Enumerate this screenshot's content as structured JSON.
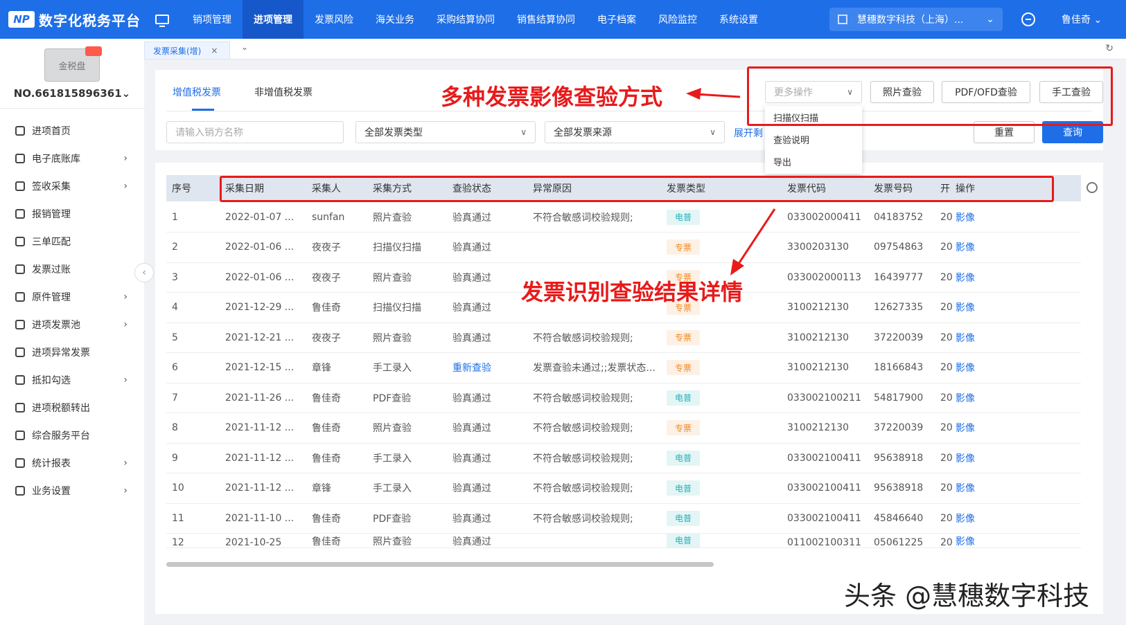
{
  "app": {
    "logo_mark": "NP",
    "title": "数字化税务平台"
  },
  "nav": [
    {
      "label": "销项管理",
      "active": false
    },
    {
      "label": "进项管理",
      "active": true
    },
    {
      "label": "发票风险",
      "active": false
    },
    {
      "label": "海关业务",
      "active": false
    },
    {
      "label": "采购结算协同",
      "active": false
    },
    {
      "label": "销售结算协同",
      "active": false
    },
    {
      "label": "电子档案",
      "active": false
    },
    {
      "label": "风险监控",
      "active": false
    },
    {
      "label": "系统设置",
      "active": false
    }
  ],
  "company": "慧穗数字科技（上海）...",
  "user": "鲁佳奇 ⌄",
  "sidebar": {
    "disk_label": "金税盘",
    "disk_no": "NO.661815896361⌄",
    "items": [
      {
        "label": "进项首页",
        "arrow": ""
      },
      {
        "label": "电子底账库",
        "arrow": "›"
      },
      {
        "label": "签收采集",
        "arrow": "›"
      },
      {
        "label": "报销管理",
        "arrow": ""
      },
      {
        "label": "三单匹配",
        "arrow": ""
      },
      {
        "label": "发票过账",
        "arrow": ""
      },
      {
        "label": "原件管理",
        "arrow": "›"
      },
      {
        "label": "进项发票池",
        "arrow": "›"
      },
      {
        "label": "进项异常发票",
        "arrow": ""
      },
      {
        "label": "抵扣勾选",
        "arrow": "›"
      },
      {
        "label": "进项税额转出",
        "arrow": ""
      },
      {
        "label": "综合服务平台",
        "arrow": ""
      },
      {
        "label": "统计报表",
        "arrow": "›"
      },
      {
        "label": "业务设置",
        "arrow": "›"
      }
    ]
  },
  "tabs": {
    "active_tab": "发票采集(增)",
    "close": "×",
    "more": "⌄",
    "refresh": "↻"
  },
  "filter": {
    "vtab_vat": "增值税发票",
    "vtab_nonvat": "非增值税发票",
    "seller_placeholder": "请输入销方名称",
    "invoice_type": "全部发票类型",
    "invoice_source": "全部发票来源",
    "expand": "展开剩",
    "more_ops": "更多操作",
    "photo_check": "照片查验",
    "pdf_check": "PDF/OFD查验",
    "manual_check": "手工查验",
    "reset": "重置",
    "query": "查询"
  },
  "dropdown": [
    "扫描仪扫描",
    "查验说明",
    "导出"
  ],
  "table": {
    "headers": [
      "序号",
      "采集日期",
      "采集人",
      "采集方式",
      "查验状态",
      "异常原因",
      "发票类型",
      "发票代码",
      "发票号码",
      "开",
      "操作"
    ],
    "rows": [
      {
        "no": "1",
        "date": "2022-01-07 ...",
        "person": "sunfan",
        "method": "照片查验",
        "status": "验真通过",
        "status_link": false,
        "reason": "不符合敏感词校验规则;",
        "type": "电普",
        "type_kind": "ep",
        "code": "033002000411",
        "num": "04183752",
        "open": "20",
        "op": "影像"
      },
      {
        "no": "2",
        "date": "2022-01-06 ...",
        "person": "夜夜子",
        "method": "扫描仪扫描",
        "status": "验真通过",
        "status_link": false,
        "reason": "",
        "type": "专票",
        "type_kind": "zp",
        "code": "3300203130",
        "num": "09754863",
        "open": "20",
        "op": "影像"
      },
      {
        "no": "3",
        "date": "2022-01-06 ...",
        "person": "夜夜子",
        "method": "照片查验",
        "status": "验真通过",
        "status_link": false,
        "reason": "",
        "type": "专票",
        "type_kind": "zp",
        "code": "033002000113",
        "num": "16439777",
        "open": "20",
        "op": "影像"
      },
      {
        "no": "4",
        "date": "2021-12-29 ...",
        "person": "鲁佳奇",
        "method": "扫描仪扫描",
        "status": "验真通过",
        "status_link": false,
        "reason": "",
        "type": "专票",
        "type_kind": "zp",
        "code": "3100212130",
        "num": "12627335",
        "open": "20",
        "op": "影像"
      },
      {
        "no": "5",
        "date": "2021-12-21 ...",
        "person": "夜夜子",
        "method": "照片查验",
        "status": "验真通过",
        "status_link": false,
        "reason": "不符合敏感词校验规则;",
        "type": "专票",
        "type_kind": "zp",
        "code": "3100212130",
        "num": "37220039",
        "open": "20",
        "op": "影像"
      },
      {
        "no": "6",
        "date": "2021-12-15 ...",
        "person": "章锋",
        "method": "手工录入",
        "status": "重新查验",
        "status_link": true,
        "reason": "发票查验未通过;;发票状态...",
        "type": "专票",
        "type_kind": "zp",
        "code": "3100212130",
        "num": "18166843",
        "open": "20",
        "op": "影像"
      },
      {
        "no": "7",
        "date": "2021-11-26 ...",
        "person": "鲁佳奇",
        "method": "PDF查验",
        "status": "验真通过",
        "status_link": false,
        "reason": "不符合敏感词校验规则;",
        "type": "电普",
        "type_kind": "ep",
        "code": "033002100211",
        "num": "54817900",
        "open": "20",
        "op": "影像"
      },
      {
        "no": "8",
        "date": "2021-11-12 ...",
        "person": "鲁佳奇",
        "method": "照片查验",
        "status": "验真通过",
        "status_link": false,
        "reason": "不符合敏感词校验规则;",
        "type": "专票",
        "type_kind": "zp",
        "code": "3100212130",
        "num": "37220039",
        "open": "20",
        "op": "影像"
      },
      {
        "no": "9",
        "date": "2021-11-12 ...",
        "person": "鲁佳奇",
        "method": "手工录入",
        "status": "验真通过",
        "status_link": false,
        "reason": "不符合敏感词校验规则;",
        "type": "电普",
        "type_kind": "ep",
        "code": "033002100411",
        "num": "95638918",
        "open": "20",
        "op": "影像"
      },
      {
        "no": "10",
        "date": "2021-11-12 ...",
        "person": "章锋",
        "method": "手工录入",
        "status": "验真通过",
        "status_link": false,
        "reason": "不符合敏感词校验规则;",
        "type": "电普",
        "type_kind": "ep",
        "code": "033002100411",
        "num": "95638918",
        "open": "20",
        "op": "影像"
      },
      {
        "no": "11",
        "date": "2021-11-10 ...",
        "person": "鲁佳奇",
        "method": "PDF查验",
        "status": "验真通过",
        "status_link": false,
        "reason": "不符合敏感词校验规则;",
        "type": "电普",
        "type_kind": "ep",
        "code": "033002100411",
        "num": "45846640",
        "open": "20",
        "op": "影像"
      },
      {
        "no": "12",
        "date": "2021-10-25",
        "person": "鲁佳奇",
        "method": "照片查验",
        "status": "验真通过",
        "status_link": false,
        "reason": "",
        "type": "电普",
        "type_kind": "ep",
        "code": "011002100311",
        "num": "05061225",
        "open": "20",
        "op": "影像"
      }
    ]
  },
  "annotations": {
    "top": "多种发票影像查验方式",
    "middle": "发票识别查验结果详情",
    "watermark": "头条 @慧穗数字科技"
  },
  "colors": {
    "primary": "#1e6ee8",
    "annotation": "#e81a1a"
  }
}
